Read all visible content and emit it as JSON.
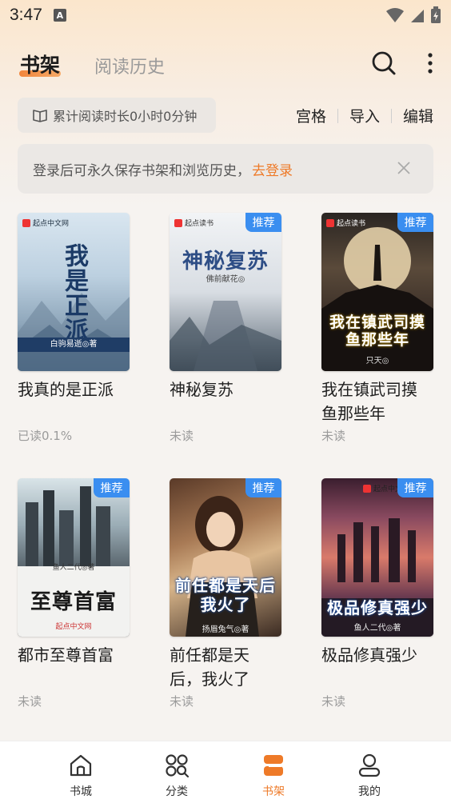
{
  "status": {
    "time": "3:47",
    "a": "A"
  },
  "header": {
    "tab_shelf": "书架",
    "tab_history": "阅读历史"
  },
  "reading": {
    "total_time": "累计阅读时长0小时0分钟"
  },
  "actions": {
    "grid": "宫格",
    "import": "导入",
    "edit": "编辑"
  },
  "login": {
    "message": "登录后可永久保存书架和浏览历史，",
    "link": "去登录"
  },
  "badge_label": "推荐",
  "books": [
    {
      "title_line1": "我真的是正派",
      "title_line2": "",
      "status": "已读0.1%",
      "recommended": false,
      "cover_title": "我是正派",
      "cover_author": "白驹易逝◎著",
      "cover_publisher": "起点中文网"
    },
    {
      "title_line1": "神秘复苏",
      "title_line2": "",
      "status": "未读",
      "recommended": true,
      "cover_title": "神秘复苏",
      "cover_author": "佛前献花◎",
      "cover_publisher": "起点读书"
    },
    {
      "title_line1": "我在镇武司摸",
      "title_line2": "鱼那些年",
      "status": "未读",
      "recommended": true,
      "cover_title": "我在镇武司摸鱼那些年",
      "cover_author": "只天◎",
      "cover_publisher": "起点读书"
    },
    {
      "title_line1": "都市至尊首富",
      "title_line2": "",
      "status": "未读",
      "recommended": true,
      "cover_title": "至尊首富",
      "cover_author": "鱼人二代◎著",
      "cover_publisher": "起点中文网"
    },
    {
      "title_line1": "前任都是天",
      "title_line2": "后，我火了",
      "status": "未读",
      "recommended": true,
      "cover_title": "前任都是天后我火了",
      "cover_author": "扬眉兔气◎著",
      "cover_publisher": ""
    },
    {
      "title_line1": "极品修真强少",
      "title_line2": "",
      "status": "未读",
      "recommended": true,
      "cover_title": "极品修真强少",
      "cover_author": "鱼人二代◎著",
      "cover_publisher": "起点中文网"
    }
  ],
  "bottom_nav": [
    {
      "label": "书城",
      "icon": "home-icon",
      "active": false
    },
    {
      "label": "分类",
      "icon": "category-icon",
      "active": false
    },
    {
      "label": "书架",
      "icon": "bookshelf-icon",
      "active": true
    },
    {
      "label": "我的",
      "icon": "profile-icon",
      "active": false
    }
  ],
  "colors": {
    "accent": "#ee7a28",
    "badge": "#3a8ef0"
  }
}
